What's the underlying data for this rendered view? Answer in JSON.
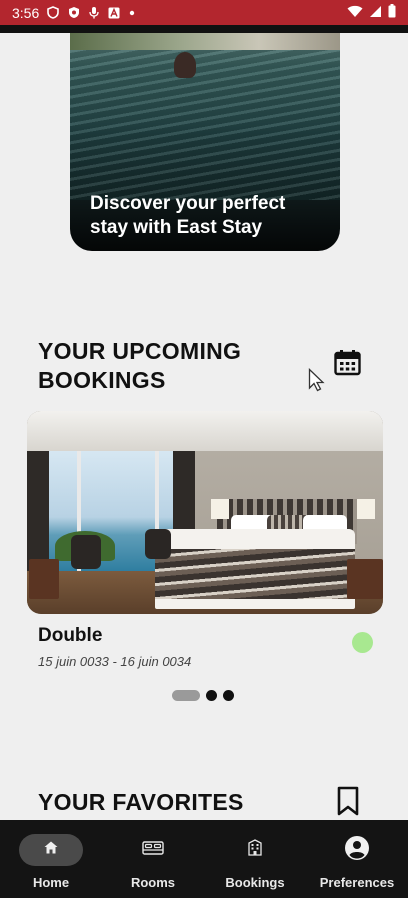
{
  "status_bar": {
    "time": "3:56",
    "left_icons": [
      "shield-icon",
      "shield-check-icon",
      "mic-icon",
      "a-box-icon",
      "dot-icon"
    ],
    "right_icons": [
      "wifi-icon",
      "signal-icon",
      "battery-icon"
    ]
  },
  "hero": {
    "text": "Discover your perfect stay with East Stay"
  },
  "upcoming": {
    "title": "YOUR UPCOMING BOOKINGS",
    "booking": {
      "room": "Double",
      "dates": "15 juin 0033 - 16 juin 0034",
      "status_color": "#a8e890"
    },
    "pager": {
      "count": 3,
      "active_index": 0
    }
  },
  "favorites": {
    "title": "YOUR FAVORITES"
  },
  "bottom_nav": {
    "items": [
      {
        "label": "Home",
        "icon": "home-icon",
        "active": true
      },
      {
        "label": "Rooms",
        "icon": "bed-icon",
        "active": false
      },
      {
        "label": "Bookings",
        "icon": "hotel-icon",
        "active": false
      },
      {
        "label": "Preferences",
        "icon": "account-circle-icon",
        "active": false
      }
    ]
  },
  "colors": {
    "status_bar": "#b3262e",
    "background": "#efefef",
    "nav_background": "#141414"
  }
}
